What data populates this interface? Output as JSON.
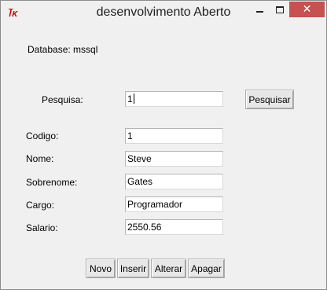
{
  "window": {
    "title": "desenvolvimento Aberto",
    "close_glyph": "✕"
  },
  "database": {
    "label": "Database: mssql"
  },
  "search": {
    "label": "Pesquisa:",
    "value": "1",
    "button_label": "Pesquisar"
  },
  "fields": [
    {
      "label": "Codigo:",
      "value": "1"
    },
    {
      "label": "Nome:",
      "value": "Steve"
    },
    {
      "label": "Sobrenome:",
      "value": "Gates"
    },
    {
      "label": "Cargo:",
      "value": "Programador"
    },
    {
      "label": "Salario:",
      "value": "2550.56"
    }
  ],
  "actions": {
    "novo": "Novo",
    "inserir": "Inserir",
    "alterar": "Alterar",
    "apagar": "Apagar"
  },
  "icons": {
    "app": "tk-feather-icon",
    "minimize": "minimize-icon",
    "maximize": "maximize-icon",
    "close": "close-icon"
  },
  "colors": {
    "close_button": "#c75050",
    "app_icon": "#d40000"
  }
}
